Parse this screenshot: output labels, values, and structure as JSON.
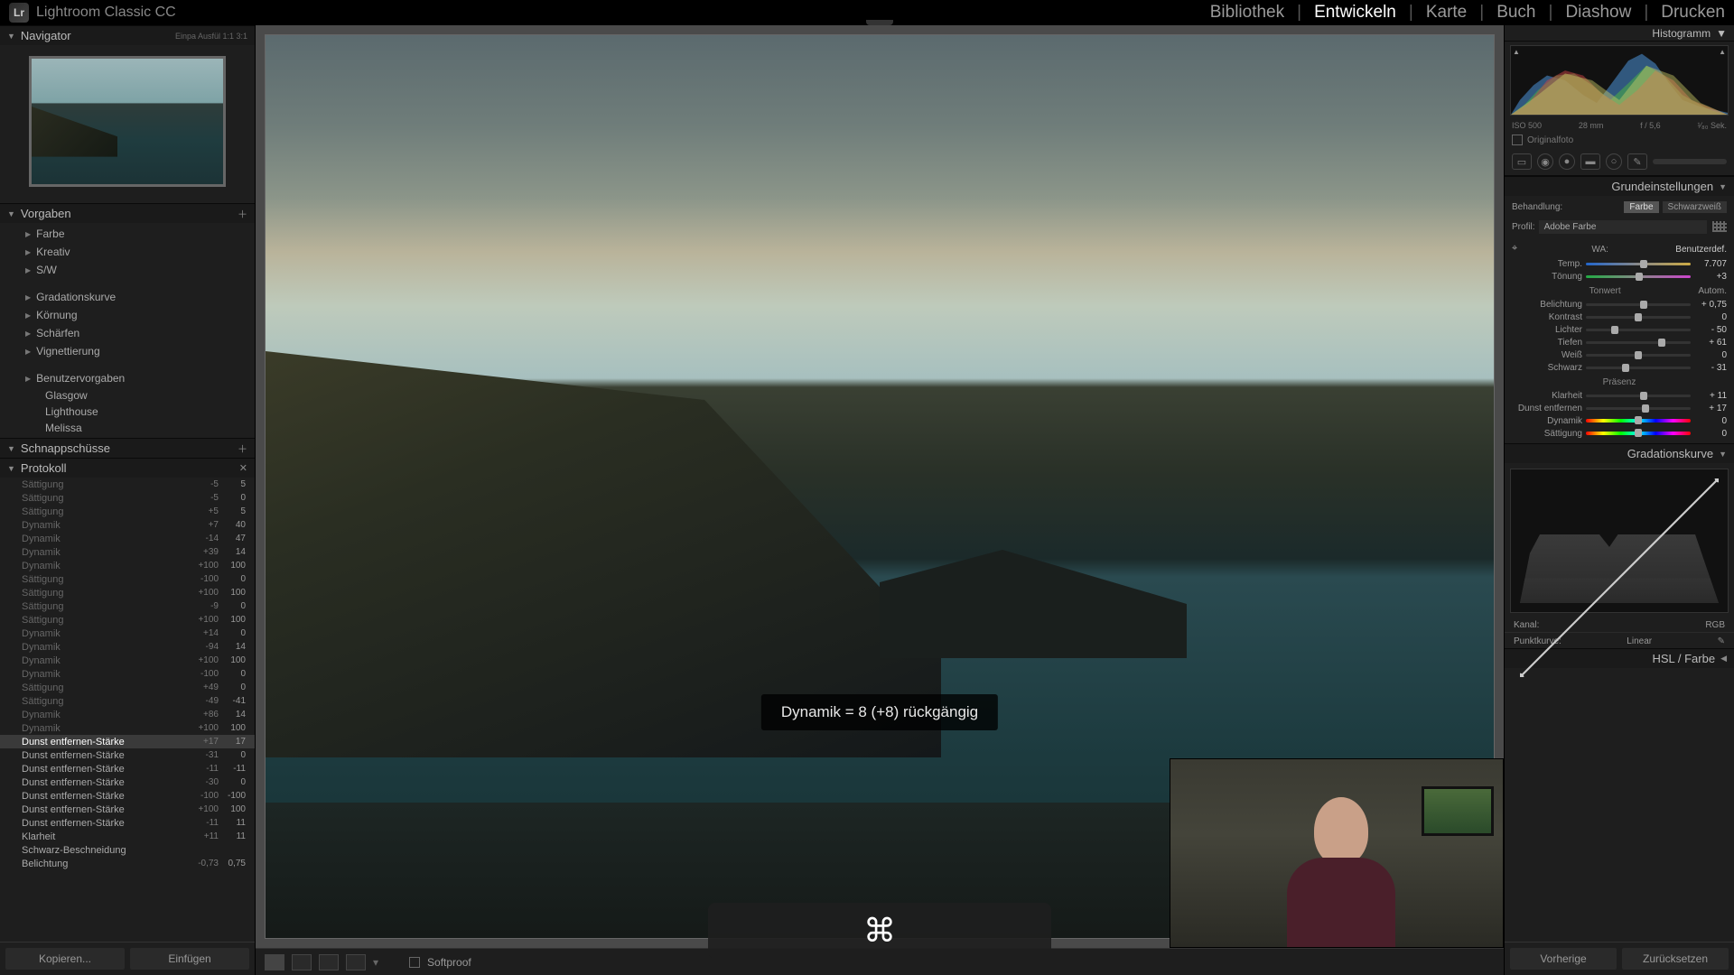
{
  "app": {
    "product": "Lightroom Classic CC",
    "logo": "Lr"
  },
  "modules": {
    "items": [
      "Bibliothek",
      "Entwickeln",
      "Karte",
      "Buch",
      "Diashow",
      "Drucken"
    ],
    "active": "Entwickeln"
  },
  "leftPanels": {
    "navigator": {
      "title": "Navigator",
      "modes": "Einpa   Ausfül   1:1   3:1"
    },
    "presets": {
      "title": "Vorgaben",
      "groupsTop": [
        "Farbe",
        "Kreativ",
        "S/W"
      ],
      "groupsMid": [
        "Gradationskurve",
        "Körnung",
        "Schärfen",
        "Vignettierung"
      ],
      "userGroup": "Benutzervorgaben",
      "userItems": [
        "Glasgow",
        "Lighthouse",
        "Melissa"
      ]
    },
    "snapshots": {
      "title": "Schnappschüsse"
    },
    "history": {
      "title": "Protokoll",
      "entries": [
        {
          "name": "Sättigung",
          "v1": "-5",
          "v2": "5",
          "dim": true
        },
        {
          "name": "Sättigung",
          "v1": "-5",
          "v2": "0",
          "dim": true
        },
        {
          "name": "Sättigung",
          "v1": "+5",
          "v2": "5",
          "dim": true
        },
        {
          "name": "Dynamik",
          "v1": "+7",
          "v2": "40",
          "dim": true
        },
        {
          "name": "Dynamik",
          "v1": "-14",
          "v2": "47",
          "dim": true
        },
        {
          "name": "Dynamik",
          "v1": "+39",
          "v2": "14",
          "dim": true
        },
        {
          "name": "Dynamik",
          "v1": "+100",
          "v2": "100",
          "dim": true
        },
        {
          "name": "Sättigung",
          "v1": "-100",
          "v2": "0",
          "dim": true
        },
        {
          "name": "Sättigung",
          "v1": "+100",
          "v2": "100",
          "dim": true
        },
        {
          "name": "Sättigung",
          "v1": "-9",
          "v2": "0",
          "dim": true
        },
        {
          "name": "Sättigung",
          "v1": "+100",
          "v2": "100",
          "dim": true
        },
        {
          "name": "Dynamik",
          "v1": "+14",
          "v2": "0",
          "dim": true
        },
        {
          "name": "Dynamik",
          "v1": "-94",
          "v2": "14",
          "dim": true
        },
        {
          "name": "Dynamik",
          "v1": "+100",
          "v2": "100",
          "dim": true
        },
        {
          "name": "Dynamik",
          "v1": "-100",
          "v2": "0",
          "dim": true
        },
        {
          "name": "Sättigung",
          "v1": "+49",
          "v2": "0",
          "dim": true
        },
        {
          "name": "Sättigung",
          "v1": "-49",
          "v2": "-41",
          "dim": true
        },
        {
          "name": "Dynamik",
          "v1": "+86",
          "v2": "14",
          "dim": true
        },
        {
          "name": "Dynamik",
          "v1": "+100",
          "v2": "100",
          "dim": true
        },
        {
          "name": "Dunst entfernen-Stärke",
          "v1": "+17",
          "v2": "17",
          "sel": true
        },
        {
          "name": "Dunst entfernen-Stärke",
          "v1": "-31",
          "v2": "0"
        },
        {
          "name": "Dunst entfernen-Stärke",
          "v1": "-11",
          "v2": "-11"
        },
        {
          "name": "Dunst entfernen-Stärke",
          "v1": "-30",
          "v2": "0"
        },
        {
          "name": "Dunst entfernen-Stärke",
          "v1": "-100",
          "v2": "-100"
        },
        {
          "name": "Dunst entfernen-Stärke",
          "v1": "+100",
          "v2": "100"
        },
        {
          "name": "Dunst entfernen-Stärke",
          "v1": "-11",
          "v2": "11"
        },
        {
          "name": "Klarheit",
          "v1": "+11",
          "v2": "11"
        },
        {
          "name": "Schwarz-Beschneidung",
          "v1": "",
          "v2": ""
        },
        {
          "name": "Belichtung",
          "v1": "-0,73",
          "v2": "0,75"
        }
      ]
    },
    "copyBtn": "Kopieren...",
    "pasteBtn": "Einfügen"
  },
  "centerBar": {
    "softproof": "Softproof"
  },
  "toast": "Dynamik = 8 (+8) rückgängig",
  "keyOverlay": "⌘",
  "rightPanels": {
    "histogram": {
      "title": "Histogramm",
      "meta": {
        "iso": "ISO 500",
        "focal": "28 mm",
        "aperture": "f / 5,6",
        "shutter": "¹⁄₈₀ Sek."
      },
      "original": "Originalfoto"
    },
    "basic": {
      "title": "Grundeinstellungen",
      "treatment": {
        "label": "Behandlung:",
        "color": "Farbe",
        "bw": "Schwarzweiß"
      },
      "profile": {
        "label": "Profil:",
        "value": "Adobe Farbe"
      },
      "wb": {
        "label": "WA:",
        "value": "Benutzerdef."
      },
      "temp": {
        "label": "Temp.",
        "value": "7.707"
      },
      "tint": {
        "label": "Tönung",
        "value": "+3"
      },
      "tonesTitle": "Tonwert",
      "auto": "Autom.",
      "sliders": [
        {
          "label": "Belichtung",
          "value": "+ 0,75",
          "pos": 55
        },
        {
          "label": "Kontrast",
          "value": "0",
          "pos": 50
        },
        {
          "label": "Lichter",
          "value": "- 50",
          "pos": 28
        },
        {
          "label": "Tiefen",
          "value": "+ 61",
          "pos": 72
        },
        {
          "label": "Weiß",
          "value": "0",
          "pos": 50
        },
        {
          "label": "Schwarz",
          "value": "- 31",
          "pos": 38
        }
      ],
      "presenceTitle": "Präsenz",
      "presence": [
        {
          "label": "Klarheit",
          "value": "+ 11",
          "pos": 55
        },
        {
          "label": "Dunst entfernen",
          "value": "+ 17",
          "pos": 57
        },
        {
          "label": "Dynamik",
          "value": "0",
          "pos": 50,
          "rainbow": true
        },
        {
          "label": "Sättigung",
          "value": "0",
          "pos": 50,
          "rainbow": true
        }
      ]
    },
    "curve": {
      "title": "Gradationskurve",
      "channel": {
        "label": "Kanal:",
        "value": "RGB"
      },
      "pointCurve": {
        "label": "Punktkurve:",
        "value": "Linear"
      }
    },
    "hsl": {
      "title": "HSL / Farbe"
    },
    "prevBtn": "Vorherige",
    "resetBtn": "Zurücksetzen"
  }
}
